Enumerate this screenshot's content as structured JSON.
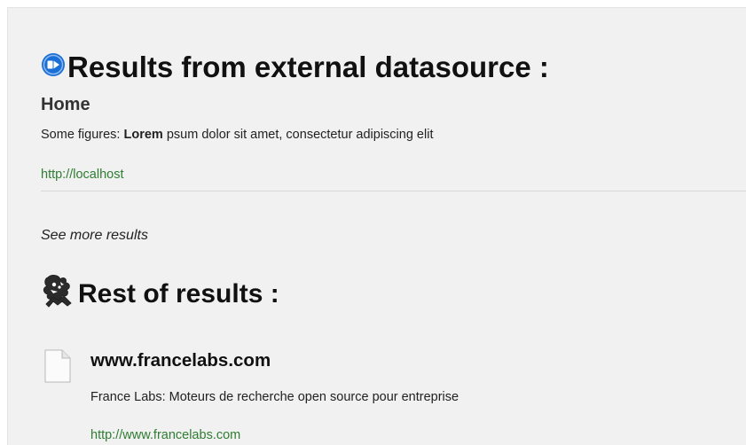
{
  "external": {
    "heading": "Results from external datasource :",
    "icon": "circle-arrow-icon",
    "result": {
      "title": "Home",
      "snippet_prefix": "Some figures: ",
      "snippet_bold": "Lorem",
      "snippet_suffix": " psum dolor sit amet, consectetur adipiscing elit",
      "url": "http://localhost"
    },
    "see_more": "See more results"
  },
  "rest": {
    "heading": "Rest of results :",
    "icon": "mascot-icon",
    "results": [
      {
        "title": "www.francelabs.com",
        "snippet": "France Labs: Moteurs de recherche open source pour entreprise",
        "url": "http://www.francelabs.com",
        "icon": "document-icon"
      }
    ]
  },
  "colors": {
    "url_green": "#2e7d32",
    "icon_blue": "#1a6fd6",
    "background": "#f1f1f1"
  }
}
